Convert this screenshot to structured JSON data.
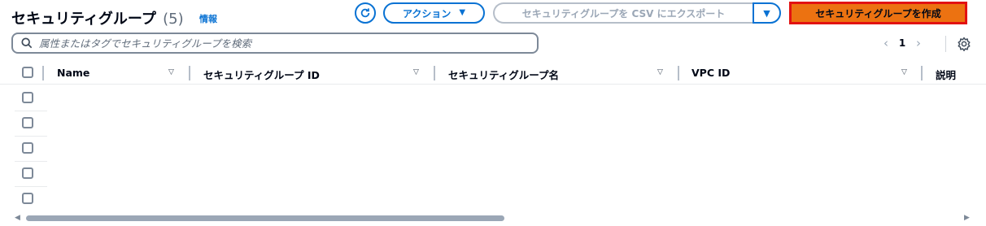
{
  "header": {
    "title": "セキュリティグループ",
    "count": "(5)",
    "info_link": "情報"
  },
  "toolbar": {
    "refresh_icon": "refresh-icon",
    "actions_label": "アクション",
    "export_label": "セキュリティグループを CSV にエクスポート",
    "create_label": "セキュリティグループを作成"
  },
  "search": {
    "placeholder": "属性またはタグでセキュリティグループを検索"
  },
  "pagination": {
    "current_page": "1",
    "prev_icon": "chevron-left-icon",
    "next_icon": "chevron-right-icon",
    "settings_icon": "gear-icon"
  },
  "table": {
    "columns": [
      {
        "label": "Name"
      },
      {
        "label": "セキュリティグループ ID"
      },
      {
        "label": "セキュリティグループ名"
      },
      {
        "label": "VPC ID"
      },
      {
        "label": "説明"
      }
    ],
    "row_count": 5
  },
  "colors": {
    "accent": "#0972d3",
    "primary_button": "#ec7211",
    "highlight_border": "#e21212"
  }
}
